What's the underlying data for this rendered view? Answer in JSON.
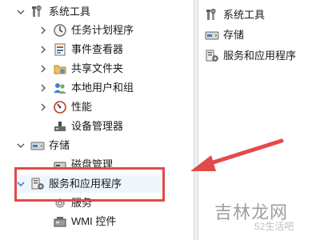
{
  "tree": {
    "items": [
      {
        "label": "系统工具",
        "icon": "tools-icon",
        "expanded": true
      },
      {
        "label": "任务计划程序",
        "icon": "task-scheduler-icon"
      },
      {
        "label": "事件查看器",
        "icon": "event-viewer-icon"
      },
      {
        "label": "共享文件夹",
        "icon": "shared-folders-icon"
      },
      {
        "label": "本地用户和组",
        "icon": "local-users-icon"
      },
      {
        "label": "性能",
        "icon": "performance-icon"
      },
      {
        "label": "设备管理器",
        "icon": "device-manager-icon"
      },
      {
        "label": "存储",
        "icon": "storage-icon",
        "expanded": true
      },
      {
        "label": "磁盘管理",
        "icon": "disk-management-icon"
      },
      {
        "label": "服务和应用程序",
        "icon": "services-apps-icon",
        "expanded": true,
        "selected": true
      },
      {
        "label": "服务",
        "icon": "services-gear-icon"
      },
      {
        "label": "WMI 控件",
        "icon": "wmi-control-icon"
      }
    ]
  },
  "list": {
    "items": [
      {
        "label": "系统工具",
        "icon": "tools-icon"
      },
      {
        "label": "存储",
        "icon": "storage-icon"
      },
      {
        "label": "服务和应用程序",
        "icon": "services-apps-icon"
      }
    ]
  },
  "watermark": {
    "text": "吉林龙网",
    "sub": "52生活吧"
  },
  "colors": {
    "highlight": "#e34a4a",
    "chevron": "#555555",
    "selection": "#eef6fc"
  }
}
